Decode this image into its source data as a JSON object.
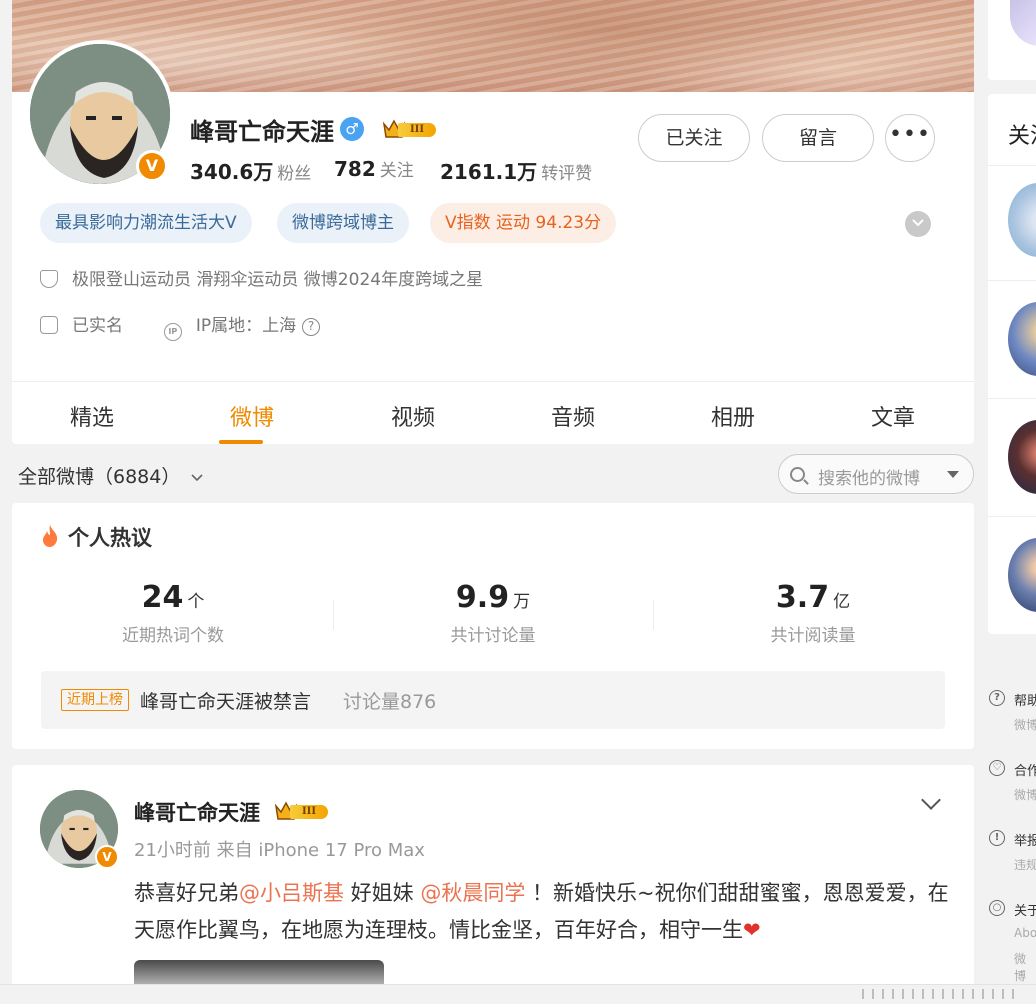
{
  "profile": {
    "name": "峰哥亡命天涯",
    "gender_symbol": "♂",
    "level_badge": "III",
    "verified_symbol": "V",
    "stats": {
      "fans_value": "340.6万",
      "fans_label": "粉丝",
      "follow_value": "782",
      "follow_label": "关注",
      "repost_value": "2161.1万",
      "repost_label": "转评赞"
    },
    "buttons": {
      "followed": "已关注",
      "message": "留言",
      "more": "•••"
    },
    "tags": [
      "最具影响力潮流生活大V",
      "微博跨域博主",
      "V指数 运动 94.23分"
    ],
    "description": "极限登山运动员 滑翔伞运动员 微博2024年度跨域之星",
    "real_name": "已实名",
    "ip_location": "IP属地：上海",
    "ip_icon_text": "IP",
    "help_symbol": "?"
  },
  "tabs": [
    "精选",
    "微博",
    "视频",
    "音频",
    "相册",
    "文章"
  ],
  "filter": {
    "all_posts": "全部微博（6884）",
    "search_placeholder": "搜索他的微博"
  },
  "hot": {
    "title": "个人热议",
    "stats": [
      {
        "value": "24",
        "unit": "个",
        "caption": "近期热词个数"
      },
      {
        "value": "9.9",
        "unit": "万",
        "caption": "共计讨论量"
      },
      {
        "value": "3.7",
        "unit": "亿",
        "caption": "共计阅读量"
      }
    ],
    "recent_badge": "近期上榜",
    "topic": "峰哥亡命天涯被禁言",
    "discussion": "讨论量876"
  },
  "post": {
    "author": "峰哥亡命天涯",
    "meta": "21小时前 来自 iPhone 17 Pro Max",
    "text_1": "恭喜好兄弟",
    "mention_1": "@小吕斯基",
    "text_2": " 好姐妹 ",
    "mention_2": "@秋晨同学",
    "text_3": " ！新婚快乐~祝你们甜甜蜜蜜，恩恩爱爱，在天愿作比翼鸟，在地愿为连理枝。情比金坚，百年好合，相守一生",
    "heart": "❤"
  },
  "sidebar": {
    "follow_title": "关注",
    "links": [
      {
        "title": "帮助",
        "sub": "微博"
      },
      {
        "title": "合作",
        "sub": "微博"
      },
      {
        "title": "举报",
        "sub": "违规"
      },
      {
        "title": "关于",
        "sub": "Abo"
      }
    ],
    "link_icons": [
      "?",
      "♡",
      "!",
      "○"
    ],
    "extra": "微博"
  },
  "colors": {
    "accent": "#f08a00",
    "mention": "#eb7350",
    "tag_blue_bg": "#eaf1f8",
    "tag_orange_bg": "#fdeee5"
  }
}
